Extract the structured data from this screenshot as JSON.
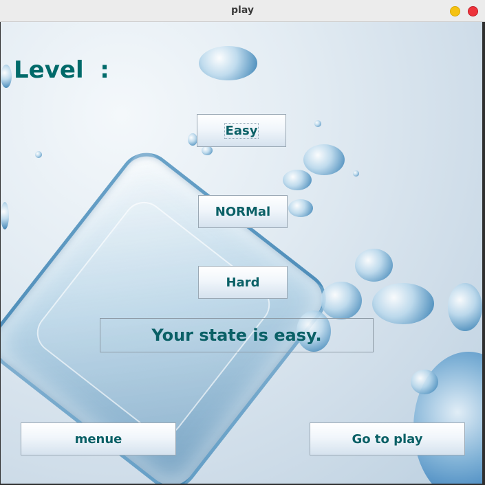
{
  "window": {
    "title": "play"
  },
  "level": {
    "label": "Level  :"
  },
  "buttons": {
    "easy": "Easy",
    "normal": "NORMal",
    "hard": "Hard",
    "menue": "menue",
    "go_to_play": "Go to play"
  },
  "state": {
    "text": "Your state is easy."
  },
  "colors": {
    "text_accent": "#006a6a",
    "close_button": "#ed333b",
    "minimize_button": "#f5c211"
  }
}
